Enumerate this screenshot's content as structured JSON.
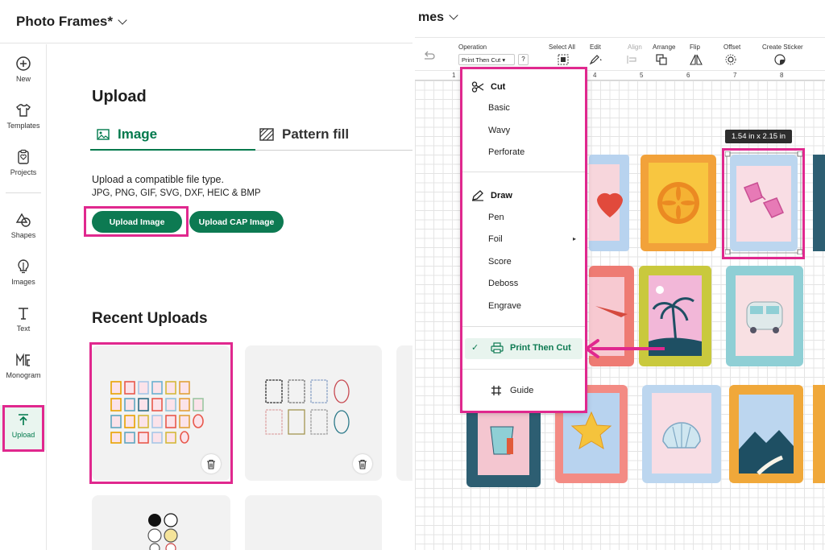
{
  "left": {
    "project_title": "Photo Frames*",
    "sidebar": [
      {
        "label": "New",
        "icon": "plus-circle-icon"
      },
      {
        "label": "Templates",
        "icon": "shirt-icon"
      },
      {
        "label": "Projects",
        "icon": "projects-icon"
      },
      {
        "label": "Shapes",
        "icon": "shapes-icon"
      },
      {
        "label": "Images",
        "icon": "lightbulb-icon"
      },
      {
        "label": "Text",
        "icon": "text-icon"
      },
      {
        "label": "Monogram",
        "icon": "monogram-icon"
      },
      {
        "label": "Upload",
        "icon": "upload-icon"
      }
    ],
    "upload_heading": "Upload",
    "tabs": [
      {
        "label": "Image",
        "icon": "image-icon"
      },
      {
        "label": "Pattern fill",
        "icon": "pattern-icon"
      }
    ],
    "desc_line1": "Upload a compatible file type.",
    "desc_line2": "JPG, PNG, GIF, SVG, DXF, HEIC & BMP",
    "upload_image_label": "Upload Image",
    "upload_cap_label": "Upload CAP Image",
    "recent_heading": "Recent Uploads"
  },
  "right": {
    "title": "mes",
    "toolbar": {
      "operation_label": "Operation",
      "operation_value": "Print Then Cut",
      "help": "?",
      "select_all": "Select All",
      "edit": "Edit",
      "align": "Align",
      "arrange": "Arrange",
      "flip": "Flip",
      "offset": "Offset",
      "create_sticker": "Create Sticker"
    },
    "ruler_ticks": [
      "1",
      "4",
      "5",
      "6",
      "7",
      "8"
    ],
    "dimension_tag": "1.54  in x 2.15  in",
    "dropdown": {
      "cut_header": "Cut",
      "cut_items": [
        "Basic",
        "Wavy",
        "Perforate"
      ],
      "draw_header": "Draw",
      "draw_items": [
        "Pen",
        "Foil",
        "Score",
        "Deboss",
        "Engrave"
      ],
      "selected": "Print Then Cut",
      "guide": "Guide"
    }
  },
  "colors": {
    "accent_green": "#0d7a52",
    "highlight_pink": "#e0288e",
    "selected_bg": "#e8f4ee"
  }
}
